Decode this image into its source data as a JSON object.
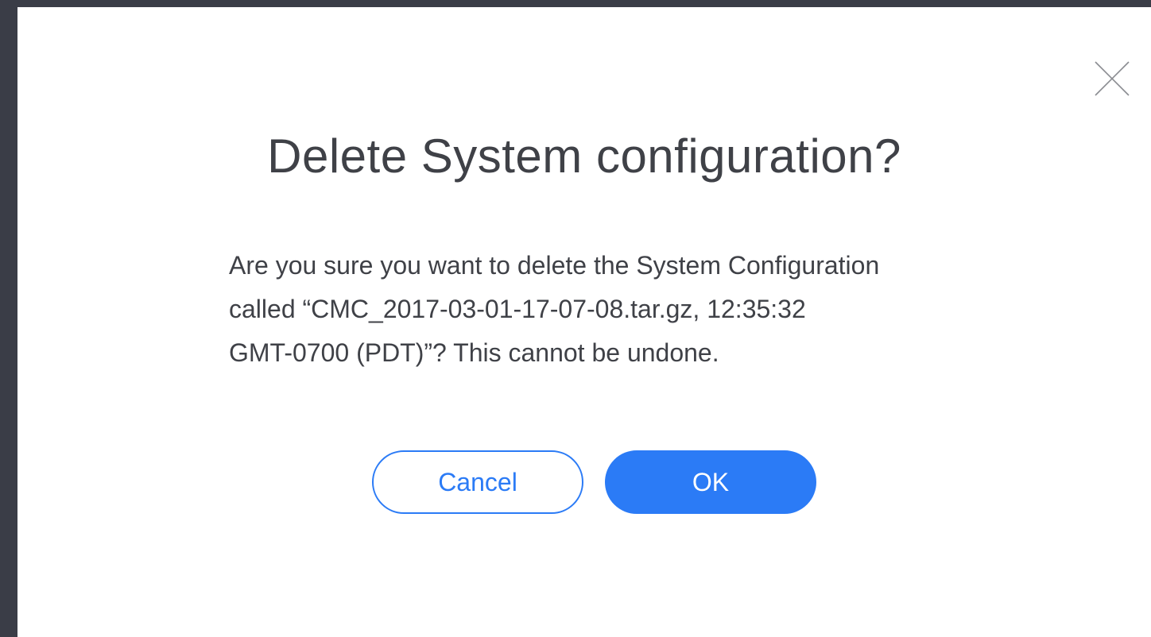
{
  "dialog": {
    "title": "Delete System configuration?",
    "message_lines": [
      "Are you sure you want to delete the System Configuration",
      "called “CMC_2017-03-01-17-07-08.tar.gz, 12:35:32",
      "GMT-0700 (PDT)”? This cannot be undone."
    ],
    "cancel_label": "Cancel",
    "ok_label": "OK",
    "close_icon": "close-icon"
  },
  "colors": {
    "backdrop": "#3a3d47",
    "dialog_background": "#ffffff",
    "text": "#3f4147",
    "accent": "#2b7bf6",
    "close_icon": "#8a8c91"
  }
}
